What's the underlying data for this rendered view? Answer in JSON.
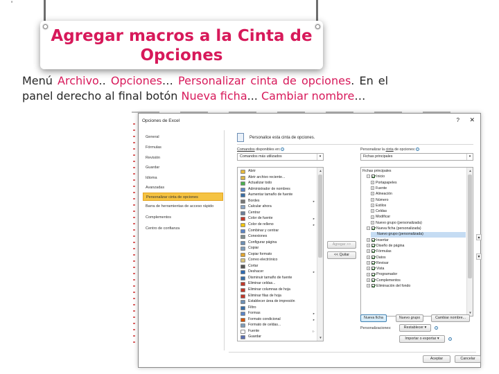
{
  "slide": {
    "stray_mark": "'",
    "title_line1": "Agregar macros a la Cinta de",
    "title_line2": "Opciones",
    "body": {
      "l1_a": "Menú ",
      "l1_b": "Archivo",
      "l1_c": ".. ",
      "l1_d": "Opciones",
      "l1_e": "…  ",
      "l1_f": "Personalizar cinta de opciones",
      "l1_g": ". En el",
      "l2_a": "panel derecho al final botón ",
      "l2_b": "Nueva ficha",
      "l2_c": "... ",
      "l2_d": "Cambiar nombre",
      "l2_e": "…"
    },
    "colors": {
      "accent": "#d7195a",
      "nav_active": "#f5c342",
      "tree_selected": "#c5dcf3"
    }
  },
  "dialog": {
    "title": "Opciones de Excel",
    "help": "?",
    "close": "✕",
    "nav": [
      "General",
      "Fórmulas",
      "Revisión",
      "Guardar",
      "Idioma",
      "Avanzadas",
      "Personalizar cinta de opciones",
      "Barra de herramientas de acceso rápido",
      "Complementos",
      "Centro de confianza"
    ],
    "header_text": "Personalice esta cinta de opciones.",
    "left_label_a": "Comandos",
    "left_label_b": " disponibles en:",
    "left_combo": "Comandos más utilizados",
    "right_label_a": "Personalizar la ",
    "right_label_b": "cinta",
    "right_label_c": " de opciones:",
    "right_combo": "Fichas principales",
    "commands": [
      {
        "label": "Abrir",
        "icon": "open-folder-icon",
        "color": "#e6b93c",
        "sub": ""
      },
      {
        "label": "Abrir archivo reciente...",
        "icon": "recent-file-icon",
        "color": "#d9b44a",
        "sub": ""
      },
      {
        "label": "Actualizar todo",
        "icon": "refresh-all-icon",
        "color": "#4caf50",
        "sub": ""
      },
      {
        "label": "Administrador de nombres",
        "icon": "name-manager-icon",
        "color": "#5b84c4",
        "sub": ""
      },
      {
        "label": "Aumentar tamaño de fuente",
        "icon": "grow-font-icon",
        "color": "#3a6ea5",
        "sub": ""
      },
      {
        "label": "Bordes",
        "icon": "borders-icon",
        "color": "#777777",
        "sub": "▸"
      },
      {
        "label": "Calcular ahora",
        "icon": "calculate-icon",
        "color": "#8aa3c2",
        "sub": ""
      },
      {
        "label": "Centrar",
        "icon": "center-align-icon",
        "color": "#6c7f99",
        "sub": ""
      },
      {
        "label": "Color de fuente",
        "icon": "font-color-icon",
        "color": "#c0392b",
        "sub": "▸"
      },
      {
        "label": "Color de relleno",
        "icon": "fill-color-icon",
        "color": "#f1c40f",
        "sub": "▸"
      },
      {
        "label": "Combinar y centrar",
        "icon": "merge-center-icon",
        "color": "#5b84c4",
        "sub": ""
      },
      {
        "label": "Conexiones",
        "icon": "connections-icon",
        "color": "#7f8c8d",
        "sub": ""
      },
      {
        "label": "Configurar página",
        "icon": "page-setup-icon",
        "color": "#6d8fb3",
        "sub": ""
      },
      {
        "label": "Copiar",
        "icon": "copy-icon",
        "color": "#7f9db9",
        "sub": ""
      },
      {
        "label": "Copiar formato",
        "icon": "format-painter-icon",
        "color": "#e0a430",
        "sub": ""
      },
      {
        "label": "Correo electrónico",
        "icon": "email-icon",
        "color": "#d9c27a",
        "sub": ""
      },
      {
        "label": "Cortar",
        "icon": "cut-icon",
        "color": "#555555",
        "sub": ""
      },
      {
        "label": "Deshacer",
        "icon": "undo-icon",
        "color": "#2e6ab1",
        "sub": "▸"
      },
      {
        "label": "Disminuir tamaño de fuente",
        "icon": "shrink-font-icon",
        "color": "#3a6ea5",
        "sub": ""
      },
      {
        "label": "Eliminar celdas...",
        "icon": "delete-cells-icon",
        "color": "#c0392b",
        "sub": ""
      },
      {
        "label": "Eliminar columnas de hoja",
        "icon": "delete-columns-icon",
        "color": "#c0392b",
        "sub": ""
      },
      {
        "label": "Eliminar filas de hoja",
        "icon": "delete-rows-icon",
        "color": "#c0392b",
        "sub": ""
      },
      {
        "label": "Establecer área de impresión",
        "icon": "print-area-icon",
        "color": "#6d8fb3",
        "sub": ""
      },
      {
        "label": "Filtro",
        "icon": "filter-icon",
        "color": "#3a6ea5",
        "sub": ""
      },
      {
        "label": "Formas",
        "icon": "shapes-icon",
        "color": "#5b84c4",
        "sub": "▸"
      },
      {
        "label": "Formato condicional",
        "icon": "conditional-format-icon",
        "color": "#d35400",
        "sub": "▸"
      },
      {
        "label": "Formato de celdas...",
        "icon": "format-cells-icon",
        "color": "#7f9db9",
        "sub": ""
      },
      {
        "label": "Fuente",
        "icon": "font-icon",
        "color": "#ffffff",
        "sub": "I·"
      },
      {
        "label": "Guardar",
        "icon": "save-icon",
        "color": "#5b6fb0",
        "sub": ""
      }
    ],
    "add_button": "Agregar >>",
    "remove_button": "<< Quitar",
    "tree": [
      {
        "label": "Fichas principales",
        "indent": 0,
        "toggle": "",
        "check": null,
        "sel": false
      },
      {
        "label": "Inicio",
        "indent": 1,
        "toggle": "−",
        "check": true,
        "sel": false
      },
      {
        "label": "Portapapeles",
        "indent": 2,
        "toggle": "+",
        "check": null,
        "sel": false
      },
      {
        "label": "Fuente",
        "indent": 2,
        "toggle": "+",
        "check": null,
        "sel": false
      },
      {
        "label": "Alineación",
        "indent": 2,
        "toggle": "+",
        "check": null,
        "sel": false
      },
      {
        "label": "Número",
        "indent": 2,
        "toggle": "+",
        "check": null,
        "sel": false
      },
      {
        "label": "Estilos",
        "indent": 2,
        "toggle": "+",
        "check": null,
        "sel": false
      },
      {
        "label": "Celdas",
        "indent": 2,
        "toggle": "+",
        "check": null,
        "sel": false
      },
      {
        "label": "Modificar",
        "indent": 2,
        "toggle": "+",
        "check": null,
        "sel": false
      },
      {
        "label": "Nuevo grupo (personalizada)",
        "indent": 2,
        "toggle": "+",
        "check": null,
        "sel": false
      },
      {
        "label": "Nueva ficha (personalizada)",
        "indent": 1,
        "toggle": "−",
        "check": true,
        "sel": false
      },
      {
        "label": "Nuevo grupo (personalizada)",
        "indent": 2,
        "toggle": "",
        "check": null,
        "sel": true
      },
      {
        "label": "Insertar",
        "indent": 1,
        "toggle": "+",
        "check": true,
        "sel": false
      },
      {
        "label": "Diseño de página",
        "indent": 1,
        "toggle": "+",
        "check": true,
        "sel": false
      },
      {
        "label": "Fórmulas",
        "indent": 1,
        "toggle": "+",
        "check": true,
        "sel": false
      },
      {
        "label": "Datos",
        "indent": 1,
        "toggle": "+",
        "check": true,
        "sel": false
      },
      {
        "label": "Revisar",
        "indent": 1,
        "toggle": "+",
        "check": true,
        "sel": false
      },
      {
        "label": "Vista",
        "indent": 1,
        "toggle": "+",
        "check": true,
        "sel": false
      },
      {
        "label": "Programador",
        "indent": 1,
        "toggle": "+",
        "check": true,
        "sel": false
      },
      {
        "label": "Complementos",
        "indent": 1,
        "toggle": "+",
        "check": true,
        "sel": false
      },
      {
        "label": "Eliminación del fondo",
        "indent": 1,
        "toggle": "+",
        "check": true,
        "sel": false
      }
    ],
    "new_tab_button": "Nueva ficha",
    "new_group_button": "Nuevo grupo",
    "rename_button": "Cambiar nombre...",
    "custom_label": "Personalizaciones:",
    "reset_button": "Restablecer ▾",
    "import_export_button": "Importar o exportar ▾",
    "ok_button": "Aceptar",
    "cancel_button": "Cancelar"
  }
}
